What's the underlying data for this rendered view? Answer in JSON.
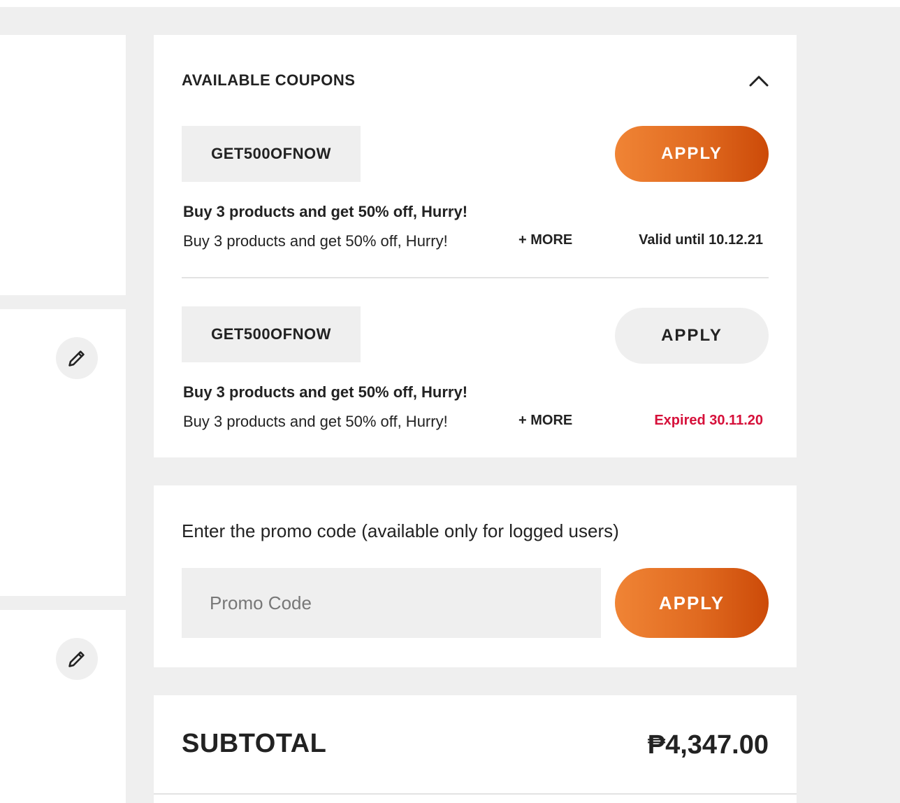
{
  "coupons": {
    "title": "AVAILABLE COUPONS",
    "items": [
      {
        "code": "GET500OFNOW",
        "apply_label": "APPLY",
        "title": "Buy 3 products and get 50% off, Hurry!",
        "description": "Buy 3 products and get 50% off, Hurry!",
        "more_label": "+ MORE",
        "validity": "Valid until 10.12.21"
      },
      {
        "code": "GET500OFNOW",
        "apply_label": "APPLY",
        "title": "Buy 3 products and get 50% off, Hurry!",
        "description": "Buy 3 products and get 50% off, Hurry!",
        "more_label": "+ MORE",
        "validity": "Expired 30.11.20"
      }
    ]
  },
  "promo": {
    "label": "Enter the promo code (available only for logged users)",
    "placeholder": "Promo Code",
    "apply_label": "APPLY"
  },
  "summary": {
    "subtotal_label": "SUBTOTAL",
    "subtotal_value": "₱4,347.00"
  },
  "colors": {
    "accent_start": "#f08435",
    "accent_end": "#cc4a08",
    "expired": "#d6103a",
    "background": "#efefef"
  },
  "icons": [
    "pencil-icon",
    "chevron-up-icon"
  ]
}
